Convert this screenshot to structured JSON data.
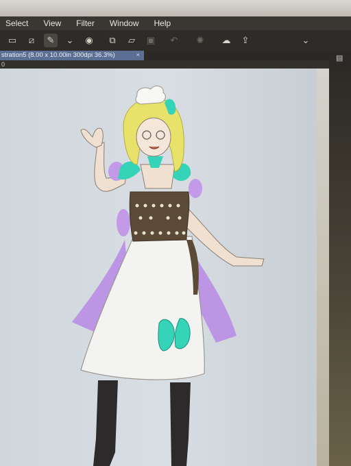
{
  "menu": {
    "items": [
      "Select",
      "View",
      "Filter",
      "Window",
      "Help"
    ]
  },
  "toolbar": {
    "icons": [
      "frame-icon",
      "transform-icon",
      "pen-tool-icon",
      "chevron-down-icon",
      "view-icon",
      "new-layer-icon",
      "folder-icon",
      "save-icon",
      "undo-icon",
      "loading-icon",
      "cloud-icon",
      "export-icon",
      "collapse-icon"
    ]
  },
  "document": {
    "tab_label": "stration5 (8.00 x 10.00in 300dpi 36.3%)",
    "close_symbol": "×",
    "subbar_text": "0"
  },
  "colors": {
    "tab_active": "#5b6f95",
    "hair": "#e8e26a",
    "ribbon_teal": "#35d3b8",
    "skirt_purple": "#b98ee6",
    "bodice_brown": "#5a4a36",
    "apron_white": "#f3f3f1"
  }
}
